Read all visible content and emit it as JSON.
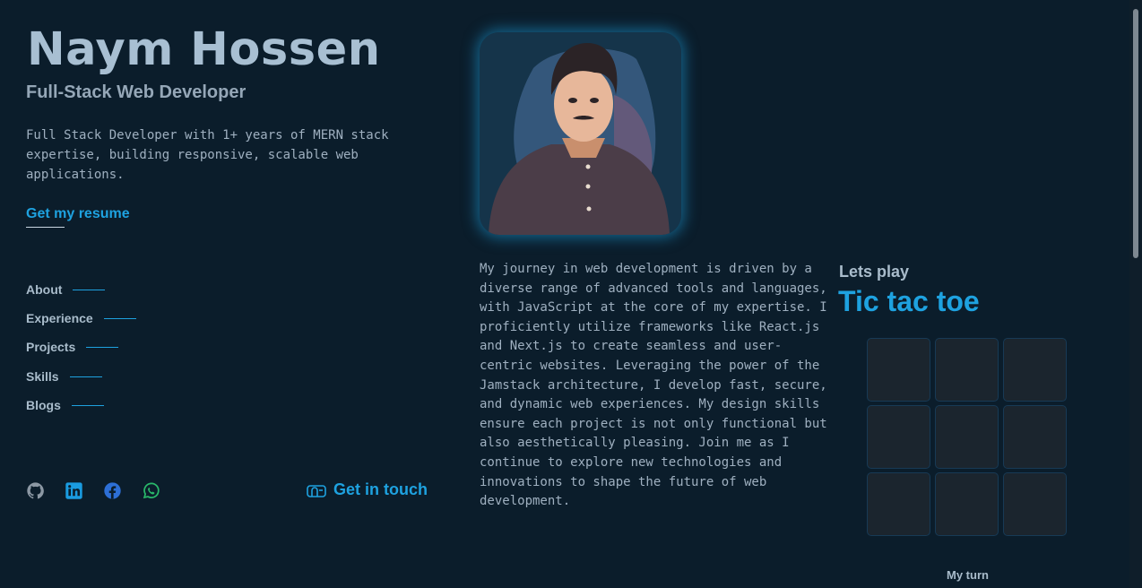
{
  "profile": {
    "name": "Naym Hossen",
    "role": "Full-Stack Web Developer",
    "summary": "Full Stack Developer with 1+ years of MERN stack expertise, building responsive, scalable web applications.",
    "resume_link": "Get my resume"
  },
  "nav": {
    "items": [
      {
        "label": "About"
      },
      {
        "label": "Experience"
      },
      {
        "label": "Projects"
      },
      {
        "label": "Skills"
      },
      {
        "label": "Blogs"
      }
    ]
  },
  "social": {
    "icons": [
      "github-icon",
      "linkedin-icon",
      "facebook-icon",
      "whatsapp-icon"
    ],
    "contact_label": "Get in touch"
  },
  "about": {
    "journey": "My journey in web development is driven by a diverse range of advanced tools and languages, with JavaScript at the core of my expertise. I proficiently utilize frameworks like React.js and Next.js to create seamless and user-centric websites. Leveraging the power of the Jamstack architecture, I develop fast, secure, and dynamic web experiences. My design skills ensure each project is not only functional but also aesthetically pleasing. Join me as I continue to explore new technologies and innovations to shape the future of web development."
  },
  "game": {
    "heading": "Lets play",
    "title": "Tic tac toe",
    "cells": [
      "",
      "",
      "",
      "",
      "",
      "",
      "",
      "",
      ""
    ],
    "status": "My turn"
  },
  "colors": {
    "background": "#0b1d2b",
    "accent": "#1ea2e0",
    "text": "#9fb0c0"
  }
}
